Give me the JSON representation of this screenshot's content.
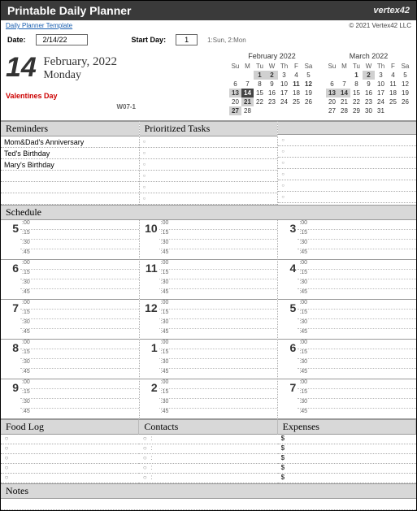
{
  "title": "Printable Daily Planner",
  "brand": "vertex42",
  "template_link": "Daily Planner Template",
  "copyright": "© 2021 Vertex42 LLC",
  "date_label": "Date:",
  "date_value": "2/14/22",
  "startday_label": "Start Day:",
  "startday_value": "1",
  "startday_hint": "1:Sun, 2:Mon",
  "big_day": "14",
  "month_year": "February, 2022",
  "weekday": "Monday",
  "holiday": "Valentines Day",
  "week_code": "W07-1",
  "cal1": {
    "title": "February 2022",
    "dow": [
      "Su",
      "M",
      "Tu",
      "W",
      "Th",
      "F",
      "Sa"
    ],
    "rows": [
      [
        "",
        "",
        "1",
        "2",
        "3",
        "4",
        "5"
      ],
      [
        "6",
        "7",
        "8",
        "9",
        "10",
        "11",
        "12"
      ],
      [
        "13",
        "14",
        "15",
        "16",
        "17",
        "18",
        "19"
      ],
      [
        "20",
        "21",
        "22",
        "23",
        "24",
        "25",
        "26"
      ],
      [
        "27",
        "28",
        "",
        "",
        "",
        "",
        ""
      ]
    ]
  },
  "cal2": {
    "title": "March 2022",
    "dow": [
      "Su",
      "M",
      "Tu",
      "W",
      "Th",
      "F",
      "Sa"
    ],
    "rows": [
      [
        "",
        "",
        "1",
        "2",
        "3",
        "4",
        "5"
      ],
      [
        "6",
        "7",
        "8",
        "9",
        "10",
        "11",
        "12"
      ],
      [
        "13",
        "14",
        "15",
        "16",
        "17",
        "18",
        "19"
      ],
      [
        "20",
        "21",
        "22",
        "23",
        "24",
        "25",
        "26"
      ],
      [
        "27",
        "28",
        "29",
        "30",
        "31",
        "",
        ""
      ]
    ]
  },
  "sections": {
    "reminders": "Reminders",
    "tasks": "Prioritized Tasks",
    "schedule": "Schedule",
    "foodlog": "Food Log",
    "contacts": "Contacts",
    "expenses": "Expenses",
    "notes": "Notes"
  },
  "reminders": [
    "Mom&Dad's Anniversary",
    "Ted's Birthday",
    "Mary's Birthday",
    "",
    "",
    ""
  ],
  "sched_hours_col1": [
    "5",
    "6",
    "7",
    "8",
    "9"
  ],
  "sched_hours_col2": [
    "10",
    "11",
    "12",
    "1",
    "2"
  ],
  "sched_hours_col3": [
    "3",
    "4",
    "5",
    "6",
    "7"
  ],
  "quarters": [
    ":00",
    ":15",
    ":30",
    ":45"
  ],
  "expense_prefix": "$"
}
